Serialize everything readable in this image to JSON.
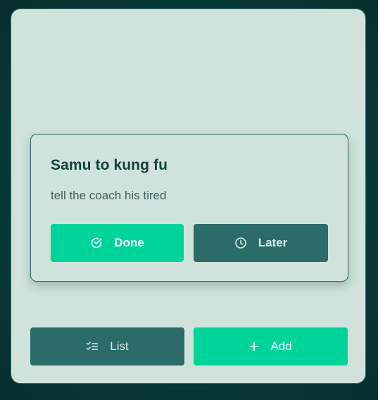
{
  "task": {
    "title": "Samu to kung fu",
    "description": "tell the coach his tired"
  },
  "actions": {
    "done_label": "Done",
    "done_icon": "check-circle-icon",
    "later_label": "Later",
    "later_icon": "clock-icon"
  },
  "footer": {
    "list_label": "List",
    "list_icon": "checklist-icon",
    "add_label": "Add",
    "add_icon": "plus-icon"
  },
  "colors": {
    "background": "#0a3d3b",
    "panel": "#cfe3dc",
    "primary": "#00d49b",
    "secondary": "#2b6b69",
    "title_text": "#13403d"
  }
}
